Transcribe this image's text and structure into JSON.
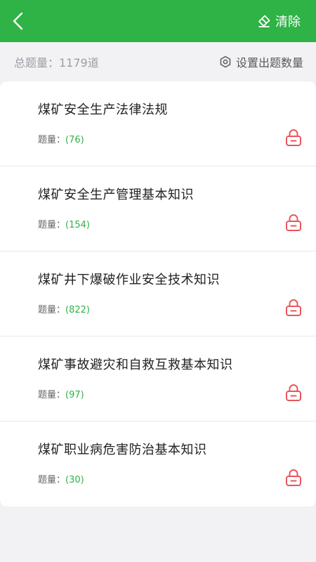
{
  "header": {
    "title": "",
    "clear_label": "清除"
  },
  "summary": {
    "total_label": "总题量：1179道",
    "settings_label": "设置出题数量"
  },
  "items": [
    {
      "title": "煤矿安全生产法律法规",
      "count_label": "题量：",
      "count": "(76)"
    },
    {
      "title": "煤矿安全生产管理基本知识",
      "count_label": "题量：",
      "count": "(154)"
    },
    {
      "title": "煤矿井下爆破作业安全技术知识",
      "count_label": "题量：",
      "count": "(822)"
    },
    {
      "title": "煤矿事故避灾和自救互救基本知识",
      "count_label": "题量：",
      "count": "(97)"
    },
    {
      "title": "煤矿职业病危害防治基本知识",
      "count_label": "题量：",
      "count": "(30)"
    }
  ],
  "colors": {
    "header_bg": "#2fb246",
    "accent": "#2fb246",
    "lock": "#e8565c"
  },
  "icons": {
    "back": "chevron-left-icon",
    "clear": "eraser-icon",
    "settings": "gear-icon",
    "lock": "lock-icon"
  }
}
